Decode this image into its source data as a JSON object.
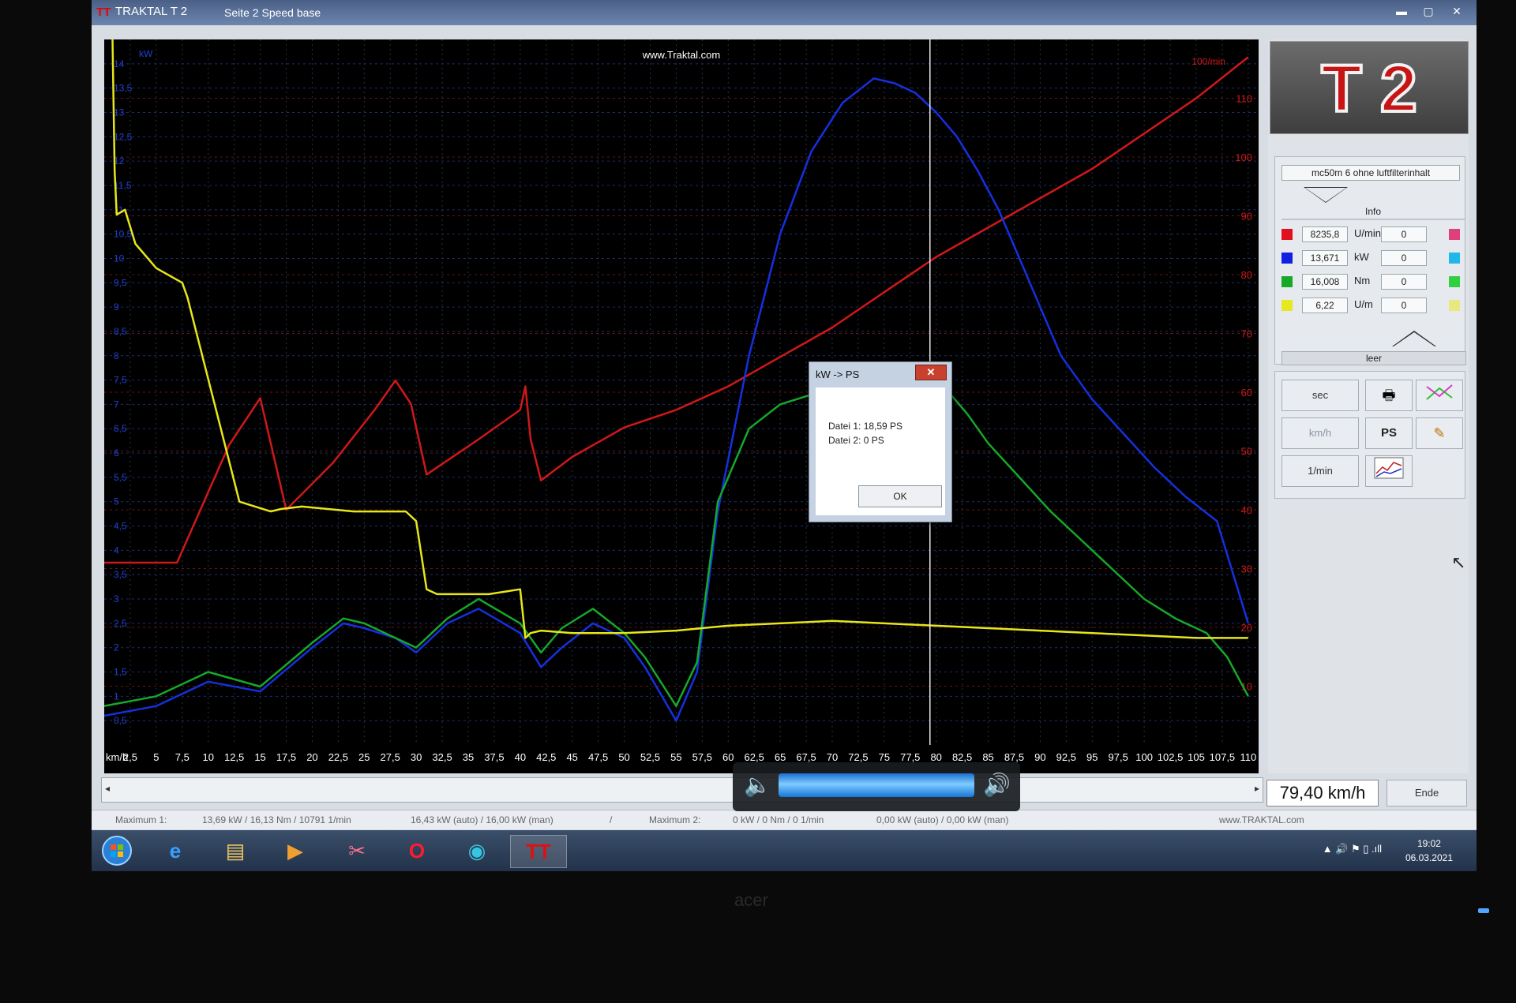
{
  "window": {
    "app_title": "TRAKTAL    T 2",
    "page_title": "Seite 2   Speed base"
  },
  "chart_data": {
    "type": "line",
    "title": "www.Traktal.com",
    "xlabel": "km/h",
    "ylabel_left": "kW",
    "ylabel_right": "100/min",
    "x_ticks": [
      "2,5",
      "5",
      "7,5",
      "10",
      "12,5",
      "15",
      "17,5",
      "20",
      "22,5",
      "25",
      "27,5",
      "30",
      "32,5",
      "35",
      "37,5",
      "40",
      "42,5",
      "45",
      "47,5",
      "50",
      "52,5",
      "55",
      "57,5",
      "60",
      "62,5",
      "65",
      "67,5",
      "70",
      "72,5",
      "75",
      "77,5",
      "80",
      "82,5",
      "85",
      "87,5",
      "90",
      "92,5",
      "95",
      "97,5",
      "100",
      "102,5",
      "105",
      "107,5",
      "110"
    ],
    "xlim": [
      0,
      111
    ],
    "left_ticks": [
      "0,5",
      "1",
      "1,5",
      "2",
      "2,5",
      "3",
      "3,5",
      "4",
      "4,5",
      "5",
      "5,5",
      "6",
      "6,5",
      "7",
      "7,5",
      "8",
      "8,5",
      "9",
      "9,5",
      "10",
      "10,5",
      "11",
      "11,5",
      "12",
      "12,5",
      "13",
      "13,5",
      "14"
    ],
    "ylim_left": [
      0,
      14.5
    ],
    "right_ticks": [
      "10",
      "20",
      "30",
      "40",
      "50",
      "60",
      "70",
      "80",
      "90",
      "100",
      "110"
    ],
    "ylim_right": [
      0,
      120
    ],
    "cursor_x": 79.4,
    "grid": true,
    "series": [
      {
        "name": "U/min",
        "axis": "right",
        "color": "#d01818",
        "x": [
          0,
          7,
          10,
          12,
          15,
          17.5,
          22,
          26,
          28,
          29.5,
          31,
          36,
          40,
          40.5,
          41,
          42,
          45,
          50,
          55,
          60,
          65,
          70,
          75,
          80,
          85,
          90,
          95,
          100,
          105,
          110
        ],
        "values": [
          31,
          31,
          43,
          51,
          59,
          40,
          48,
          57,
          62,
          58,
          46,
          52,
          57,
          61,
          52,
          45,
          49,
          54,
          57,
          61,
          66,
          71,
          77,
          83,
          88,
          93,
          98,
          104,
          110,
          117
        ]
      },
      {
        "name": "kW",
        "axis": "left",
        "color": "#1530e0",
        "x": [
          0,
          5,
          10,
          15,
          20,
          23,
          25,
          28,
          30,
          33,
          36,
          40,
          42,
          44,
          47,
          50,
          52,
          55,
          57,
          59,
          62,
          65,
          68,
          71,
          74,
          76,
          78,
          80,
          82,
          84,
          86,
          88,
          90,
          92,
          95,
          98,
          101,
          104,
          107,
          109,
          110
        ],
        "values": [
          0.6,
          0.8,
          1.3,
          1.1,
          2.0,
          2.5,
          2.4,
          2.2,
          1.9,
          2.5,
          2.8,
          2.3,
          1.6,
          2.0,
          2.5,
          2.2,
          1.6,
          0.5,
          1.5,
          4.8,
          8.0,
          10.5,
          12.2,
          13.2,
          13.7,
          13.6,
          13.4,
          13.0,
          12.5,
          11.8,
          11.0,
          10.0,
          9.0,
          8.0,
          7.1,
          6.4,
          5.7,
          5.1,
          4.6,
          3.2,
          2.5
        ]
      },
      {
        "name": "Nm",
        "axis": "left",
        "color": "#15a82a",
        "x": [
          0,
          5,
          10,
          15,
          20,
          23,
          25,
          28,
          30,
          33,
          36,
          40,
          42,
          44,
          47,
          50,
          52,
          55,
          57,
          59,
          62,
          65,
          68,
          71,
          73,
          75,
          77,
          79,
          81,
          83,
          85,
          88,
          91,
          94,
          97,
          100,
          103,
          106,
          108,
          110
        ],
        "values": [
          0.8,
          1.0,
          1.5,
          1.2,
          2.1,
          2.6,
          2.5,
          2.2,
          2.0,
          2.6,
          3.0,
          2.5,
          1.9,
          2.4,
          2.8,
          2.3,
          1.8,
          0.8,
          1.7,
          5.0,
          6.5,
          7.0,
          7.2,
          7.5,
          7.6,
          7.7,
          7.7,
          7.6,
          7.3,
          6.8,
          6.2,
          5.5,
          4.8,
          4.2,
          3.6,
          3.0,
          2.6,
          2.3,
          1.8,
          1.0
        ]
      },
      {
        "name": "U/m",
        "axis": "left",
        "color": "#e6e61a",
        "x": [
          0.8,
          1,
          1.2,
          2,
          3,
          5,
          7.5,
          8,
          13,
          16,
          17,
          19,
          24,
          29,
          30,
          31,
          32,
          37,
          40,
          40.5,
          41,
          42,
          45,
          50,
          55,
          60,
          65,
          70,
          75,
          80,
          85,
          90,
          95,
          100,
          105,
          110
        ],
        "values": [
          14.5,
          11.8,
          10.9,
          11.0,
          10.3,
          9.8,
          9.5,
          9.2,
          5.0,
          4.8,
          4.85,
          4.9,
          4.8,
          4.8,
          4.6,
          3.2,
          3.1,
          3.1,
          3.2,
          2.2,
          2.3,
          2.35,
          2.3,
          2.3,
          2.35,
          2.45,
          2.5,
          2.55,
          2.5,
          2.45,
          2.4,
          2.35,
          2.3,
          2.25,
          2.2,
          2.2
        ]
      }
    ]
  },
  "scroll": {
    "left_arrow": "◂",
    "right_arrow": "▸"
  },
  "speed_readout": "79,40 km/h",
  "ende_label": "Ende",
  "status": {
    "max1_label": "Maximum 1:",
    "max1_values": "13,69 kW  /  16,13 Nm  /  10791 1/min",
    "max1_power": "16,43 kW (auto)  /  16,00 kW (man)",
    "sep": "/",
    "max2_label": "Maximum 2:",
    "max2_values": "0 kW  /  0 Nm  /  0 1/min",
    "max2_power": "0,00 kW (auto)  /  0,00 kW (man)",
    "website": "www.TRAKTAL.com"
  },
  "panel": {
    "logo_text": "T 2",
    "file_name": "mc50m 6 ohne luftfilterinhalt",
    "info_label": "Info",
    "leer_label": "leer",
    "rows": [
      {
        "color": "#e01020",
        "value": "8235,8",
        "unit": "U/min",
        "value2": "0",
        "color2": "#e0407a"
      },
      {
        "color": "#1020e0",
        "value": "13,671",
        "unit": "kW",
        "value2": "0",
        "color2": "#20b8e8"
      },
      {
        "color": "#18a828",
        "value": "16,008",
        "unit": "Nm",
        "value2": "0",
        "color2": "#30d040"
      },
      {
        "color": "#e8e820",
        "value": "6,22",
        "unit": "U/m",
        "value2": "0",
        "color2": "#e8e880"
      }
    ],
    "buttons": {
      "sec": "sec",
      "kmh": "km/h",
      "rpm": "1/min",
      "ps": "PS"
    },
    "icons": {
      "print": "🖶",
      "wand": "✎"
    }
  },
  "dialog": {
    "title": "kW -> PS",
    "close": "✕",
    "line1": "Datei 1: 18,59 PS",
    "line2": "Datei 2: 0 PS",
    "ok_label": "OK"
  },
  "taskbar": {
    "time": "19:02",
    "date": "06.03.2021",
    "tray": "▲  🔊  ⚑  ▯  .ıll"
  },
  "bezel_brand": "acer"
}
